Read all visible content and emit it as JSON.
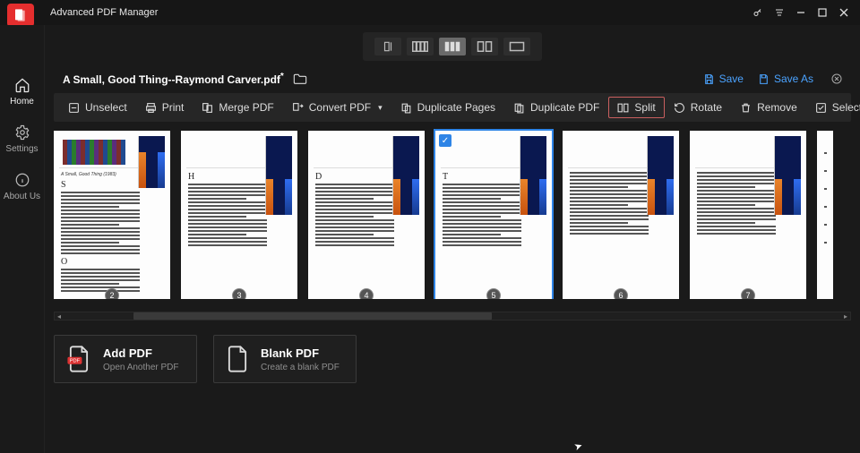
{
  "app": {
    "title": "Advanced PDF Manager"
  },
  "sidebar": {
    "items": [
      {
        "label": "Home"
      },
      {
        "label": "Settings"
      },
      {
        "label": "About Us"
      }
    ]
  },
  "file": {
    "name": "A Small, Good Thing--Raymond Carver.pdf",
    "dirty_mark": "*"
  },
  "header_actions": {
    "save": "Save",
    "save_as": "Save As"
  },
  "toolbar": {
    "unselect": "Unselect",
    "print": "Print",
    "merge": "Merge PDF",
    "convert": "Convert PDF",
    "duplicate_pages": "Duplicate Pages",
    "duplicate_pdf": "Duplicate PDF",
    "split": "Split",
    "rotate": "Rotate",
    "remove": "Remove",
    "select_all": "Select All"
  },
  "thumbnails": [
    {
      "page": "2",
      "selected": false,
      "has_books_header": true,
      "dropcap": "S",
      "second_drop": "O"
    },
    {
      "page": "3",
      "selected": false,
      "has_books_header": false,
      "dropcap": "H",
      "second_drop": ""
    },
    {
      "page": "4",
      "selected": false,
      "has_books_header": false,
      "dropcap": "D",
      "second_drop": ""
    },
    {
      "page": "5",
      "selected": true,
      "has_books_header": false,
      "dropcap": "T",
      "second_drop": ""
    },
    {
      "page": "6",
      "selected": false,
      "has_books_header": false,
      "dropcap": "",
      "second_drop": ""
    },
    {
      "page": "7",
      "selected": false,
      "has_books_header": false,
      "dropcap": "",
      "second_drop": ""
    }
  ],
  "cards": {
    "add": {
      "title": "Add PDF",
      "sub": "Open Another PDF",
      "badge": "PDF"
    },
    "blank": {
      "title": "Blank PDF",
      "sub": "Create a blank PDF"
    }
  }
}
